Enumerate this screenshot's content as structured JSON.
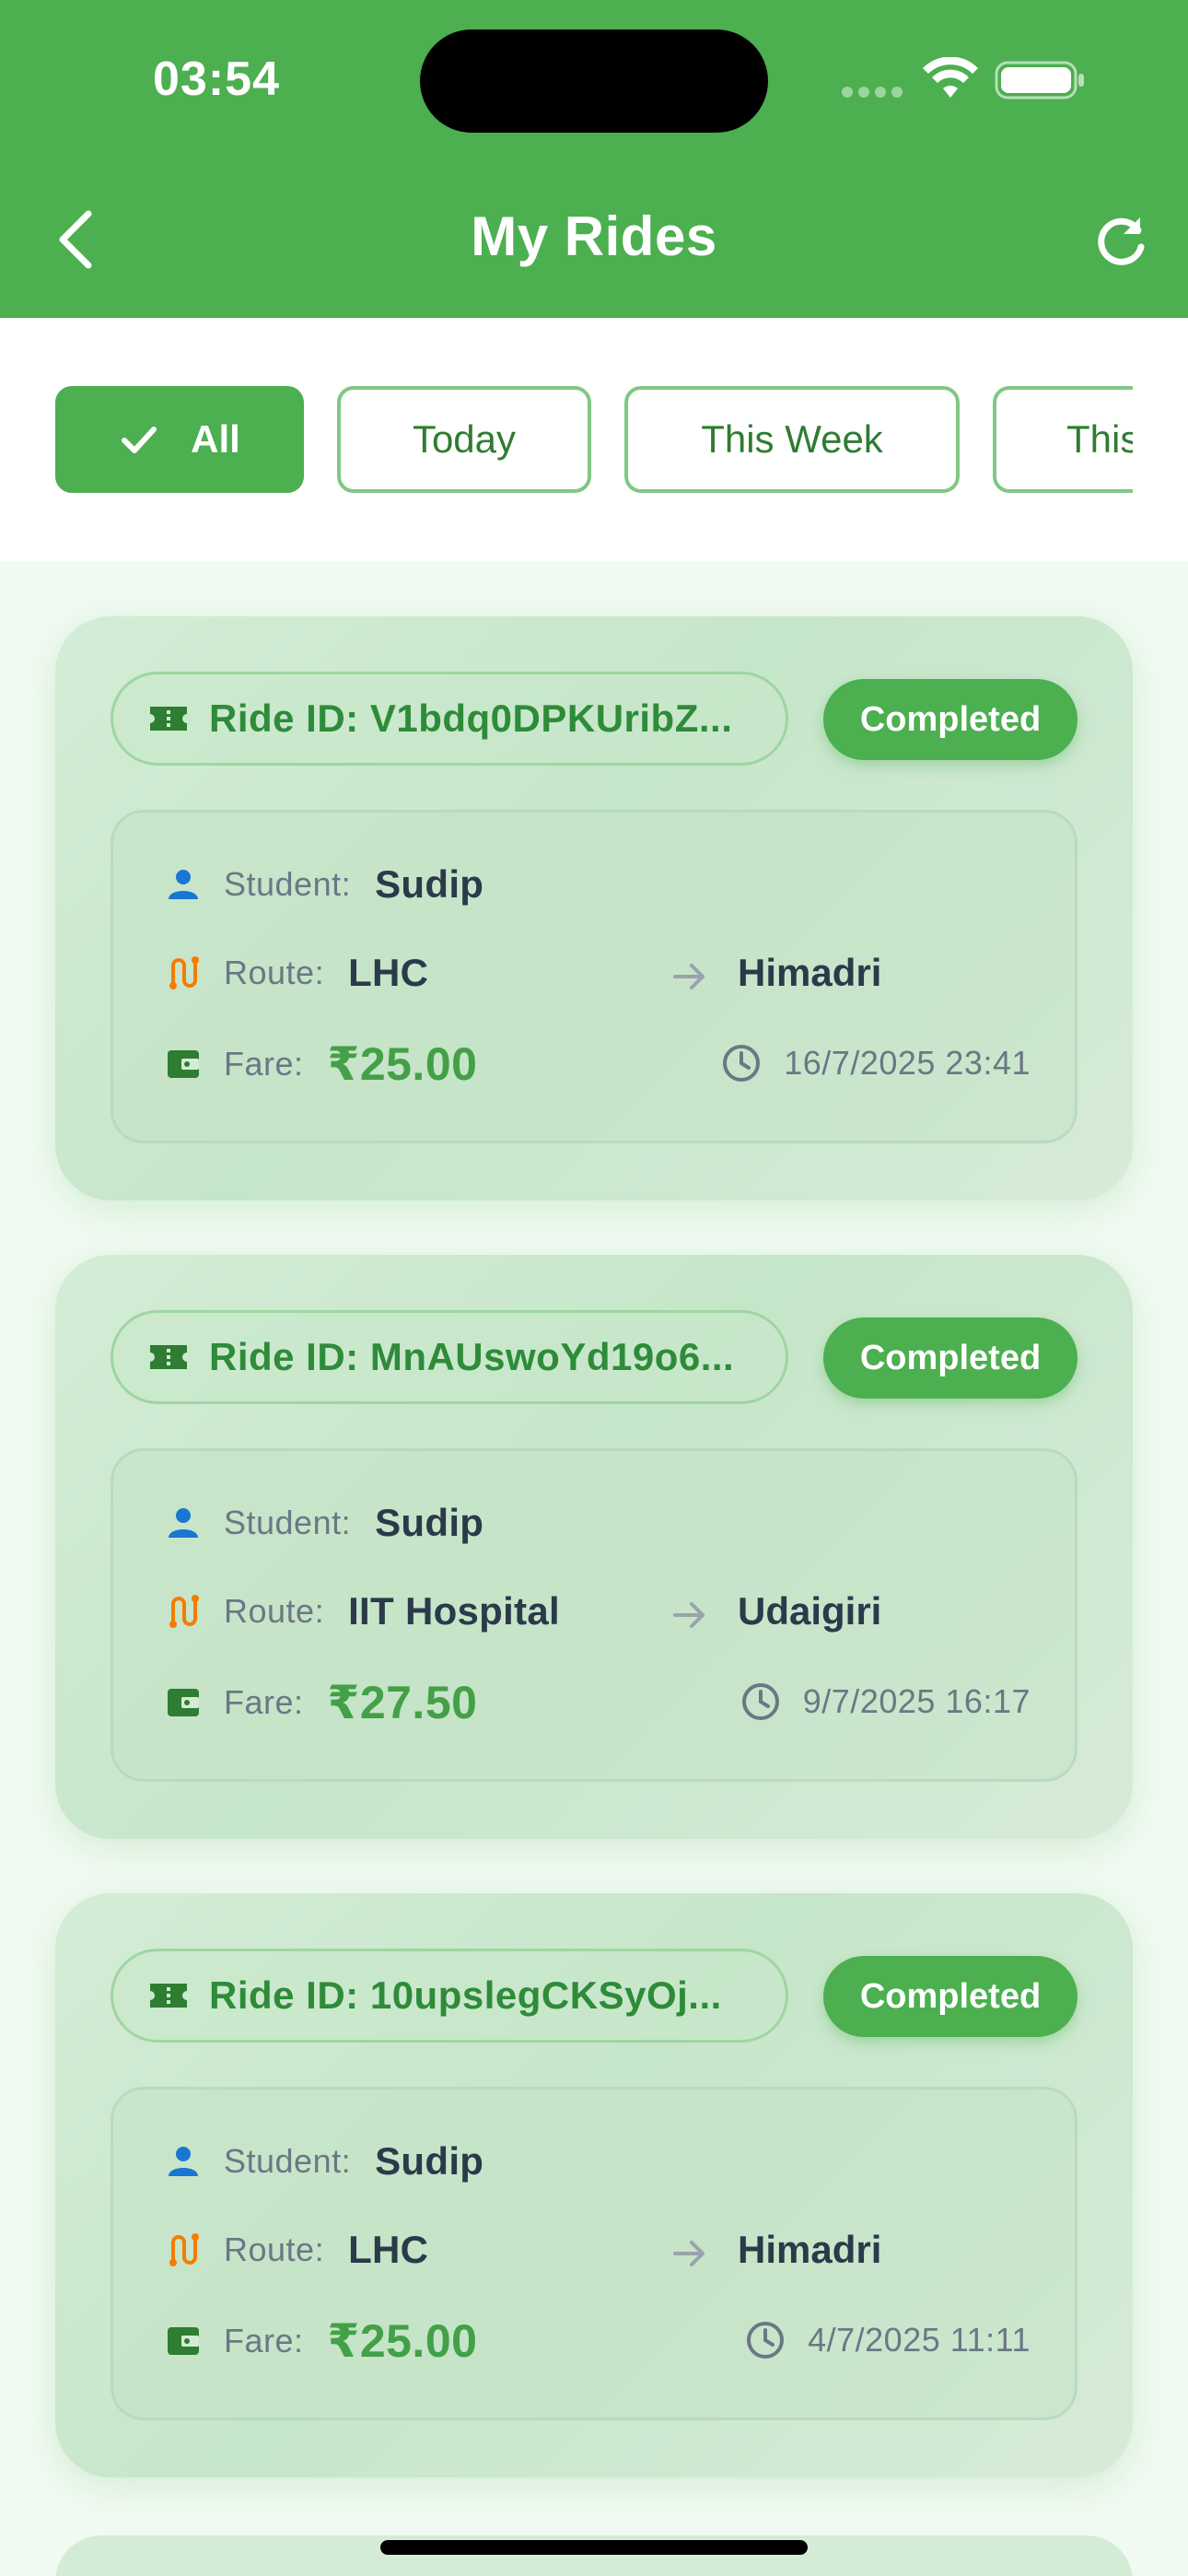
{
  "status_bar": {
    "time": "03:54"
  },
  "header": {
    "title": "My Rides"
  },
  "filters": [
    {
      "label": "All",
      "active": true
    },
    {
      "label": "Today",
      "active": false
    },
    {
      "label": "This Week",
      "active": false
    },
    {
      "label": "This Month",
      "active": false
    }
  ],
  "colors": {
    "primary": "#4caf50",
    "accent_text": "#2e7d32",
    "route_icon": "#f57c00",
    "student_icon": "#1976d2"
  },
  "rides": [
    {
      "ride_id": "Ride ID: V1bdq0DPKUribZ...",
      "status": "Completed",
      "student_label": "Student:",
      "student": "Sudip",
      "route_label": "Route:",
      "from": "LHC",
      "to": "Himadri",
      "fare_label": "Fare:",
      "fare": "₹25.00",
      "datetime": "16/7/2025 23:41"
    },
    {
      "ride_id": "Ride ID: MnAUswoYd19o6...",
      "status": "Completed",
      "student_label": "Student:",
      "student": "Sudip",
      "route_label": "Route:",
      "from": "IIT Hospital",
      "to": "Udaigiri",
      "fare_label": "Fare:",
      "fare": "₹27.50",
      "datetime": "9/7/2025 16:17"
    },
    {
      "ride_id": "Ride ID: 10upslegCKSyOj...",
      "status": "Completed",
      "student_label": "Student:",
      "student": "Sudip",
      "route_label": "Route:",
      "from": "LHC",
      "to": "Himadri",
      "fare_label": "Fare:",
      "fare": "₹25.00",
      "datetime": "4/7/2025 11:11"
    }
  ]
}
